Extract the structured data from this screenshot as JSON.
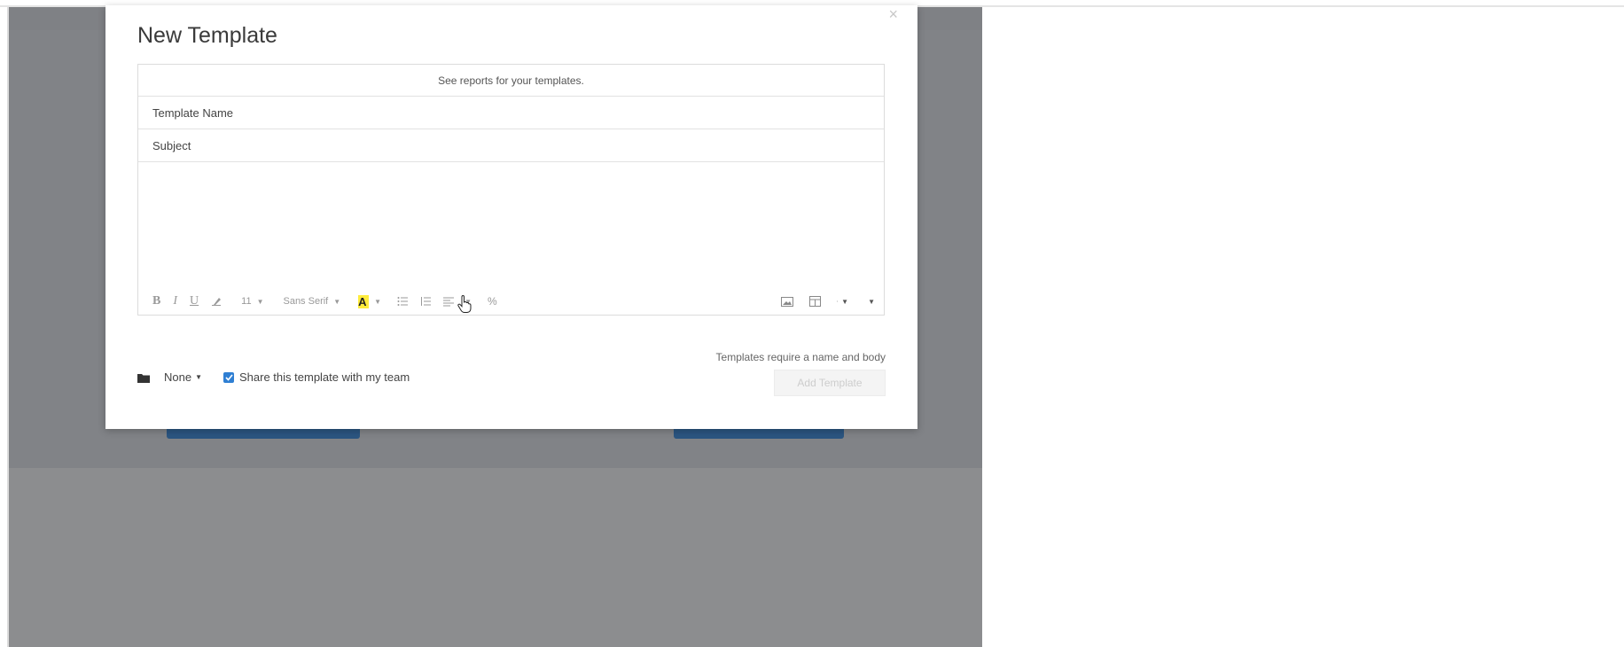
{
  "modal": {
    "title": "New Template",
    "close_glyph": "×",
    "reports_link": "See reports for your templates.",
    "template_name_placeholder": "Template Name",
    "subject_placeholder": "Subject",
    "validation_message": "Templates require a name and body",
    "add_button_label": "Add Template"
  },
  "toolbar": {
    "bold": "B",
    "italic": "I",
    "underline": "U",
    "font_size": "11",
    "font_family": "Sans Serif",
    "color_letter": "A",
    "link_glyph": "%",
    "highlight_color": "#ffec3d"
  },
  "footer": {
    "folder_label": "None",
    "share_label": "Share this template with my team",
    "share_checked": true
  },
  "colors": {
    "checkbox_accent": "#2f7fd3",
    "background_button": "#2b5580"
  }
}
